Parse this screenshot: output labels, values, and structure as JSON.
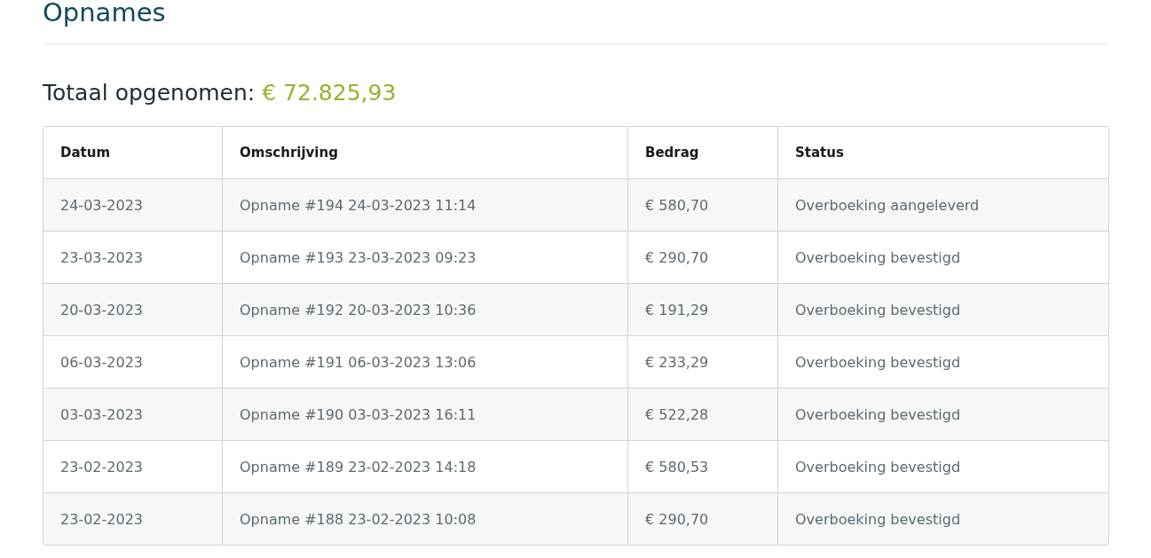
{
  "page": {
    "title": "Opnames"
  },
  "total": {
    "label": "Totaal opgenomen:",
    "amount": "€ 72.825,93"
  },
  "table": {
    "columns": [
      "Datum",
      "Omschrijving",
      "Bedrag",
      "Status"
    ],
    "rows": [
      [
        "24-03-2023",
        "Opname #194 24-03-2023 11:14",
        "€ 580,70",
        "Overboeking aangeleverd"
      ],
      [
        "23-03-2023",
        "Opname #193 23-03-2023 09:23",
        "€ 290,70",
        "Overboeking bevestigd"
      ],
      [
        "20-03-2023",
        "Opname #192 20-03-2023 10:36",
        "€ 191,29",
        "Overboeking bevestigd"
      ],
      [
        "06-03-2023",
        "Opname #191 06-03-2023 13:06",
        "€ 233,29",
        "Overboeking bevestigd"
      ],
      [
        "03-03-2023",
        "Opname #190 03-03-2023 16:11",
        "€ 522,28",
        "Overboeking bevestigd"
      ],
      [
        "23-02-2023",
        "Opname #189 23-02-2023 14:18",
        "€ 580,53",
        "Overboeking bevestigd"
      ],
      [
        "23-02-2023",
        "Opname #188 23-02-2023 10:08",
        "€ 290,70",
        "Overboeking bevestigd"
      ]
    ]
  }
}
